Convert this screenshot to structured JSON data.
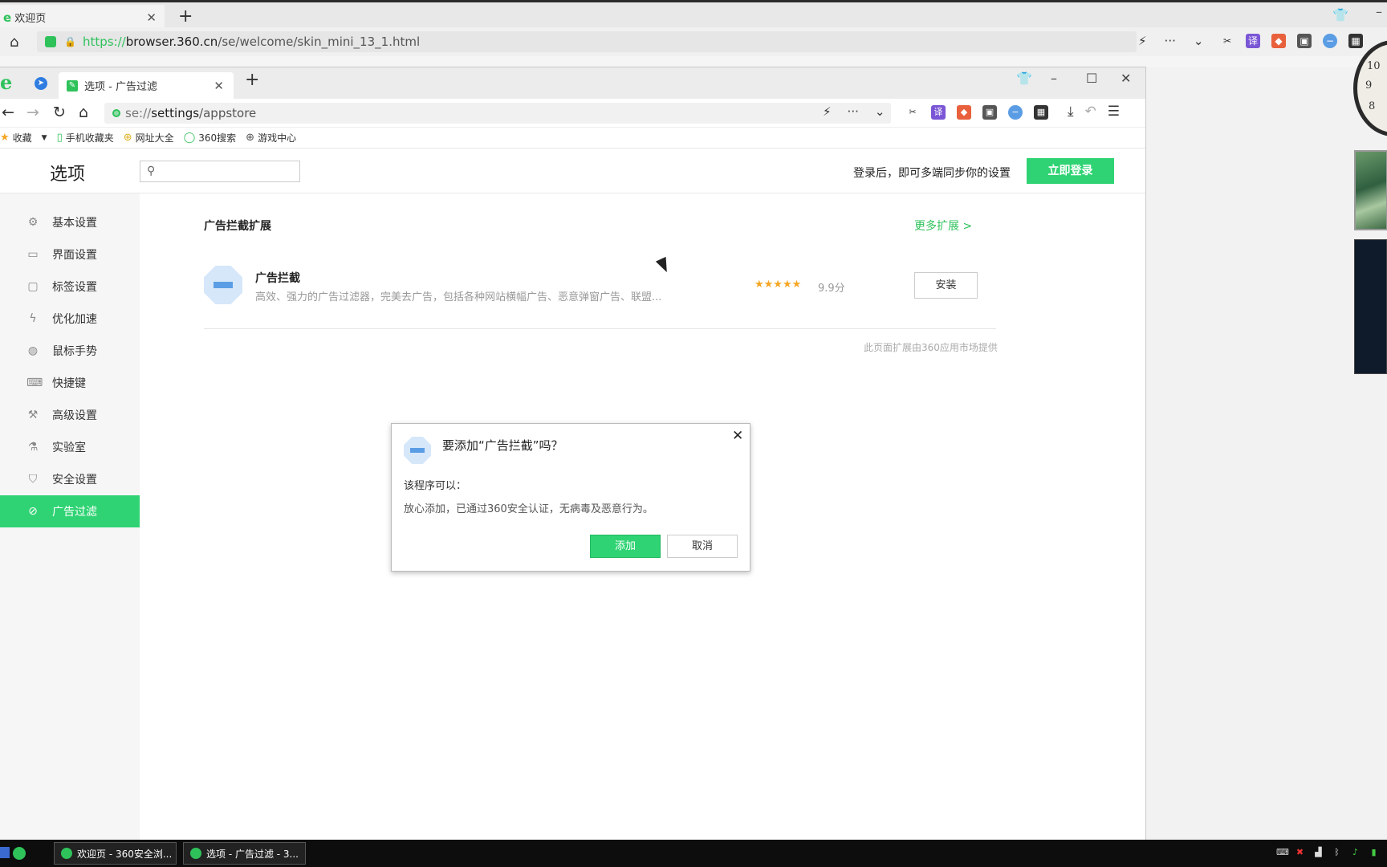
{
  "bg_window": {
    "tab_title": "欢迎页",
    "url_scheme": "https://",
    "url_host": "browser.360.cn",
    "url_path": "/se/welcome/skin_mini_13_1.html"
  },
  "window": {
    "tab_title": "选项 - 广告过滤",
    "url_scheme": "se://",
    "url_host": "settings",
    "url_path": "/appstore"
  },
  "bookmarks": [
    {
      "label": "收藏",
      "icon": "star-icon"
    },
    {
      "label": "手机收藏夹",
      "icon": "phone-icon"
    },
    {
      "label": "网址大全",
      "icon": "plus-globe-icon"
    },
    {
      "label": "360搜索",
      "icon": "search-ring-icon"
    },
    {
      "label": "游戏中心",
      "icon": "globe-icon"
    }
  ],
  "page": {
    "title": "选项",
    "search_placeholder": "",
    "login_hint": "登录后，即可多端同步你的设置",
    "login_button": "立即登录"
  },
  "sidebar": {
    "items": [
      {
        "label": "基本设置",
        "icon": "gear-icon"
      },
      {
        "label": "界面设置",
        "icon": "window-icon"
      },
      {
        "label": "标签设置",
        "icon": "tab-icon"
      },
      {
        "label": "优化加速",
        "icon": "bolt-icon"
      },
      {
        "label": "鼠标手势",
        "icon": "mouse-icon"
      },
      {
        "label": "快捷键",
        "icon": "keyboard-icon"
      },
      {
        "label": "高级设置",
        "icon": "wrench-icon"
      },
      {
        "label": "实验室",
        "icon": "flask-icon"
      },
      {
        "label": "安全设置",
        "icon": "shield-icon"
      },
      {
        "label": "广告过滤",
        "icon": "block-icon",
        "active": true
      }
    ]
  },
  "main": {
    "section_title": "广告拦截扩展",
    "more_link": "更多扩展 >",
    "extension": {
      "name": "广告拦截",
      "description": "高效、强力的广告过滤器，完美去广告，包括各种网站横幅广告、恶意弹窗广告、联盟...",
      "rating_stars": 5,
      "score": "9.9分",
      "install_label": "安装"
    },
    "provided_by": "此页面扩展由360应用市场提供"
  },
  "dialog": {
    "title": "要添加“广告拦截”吗？",
    "can_label": "该程序可以：",
    "permission": "放心添加，已通过360安全认证，无病毒及恶意行为。",
    "add_label": "添加",
    "cancel_label": "取消"
  },
  "taskbar": {
    "tasks": [
      "欢迎页 - 360安全浏...",
      "选项 - 广告过滤 - 3..."
    ]
  },
  "colors": {
    "accent_green": "#2fd373",
    "link_green": "#2fc25b",
    "star_orange": "#f5a623"
  }
}
